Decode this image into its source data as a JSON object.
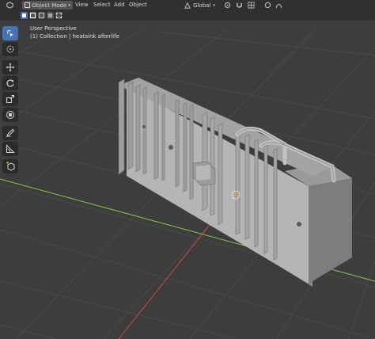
{
  "header": {
    "mode_label": "Object Mode",
    "menu": [
      "View",
      "Select",
      "Add",
      "Object"
    ],
    "transform_orientation": "Global"
  },
  "viewport": {
    "view_name": "User Perspective",
    "collection_info": "(1) Collection | heatsink afterlife"
  },
  "toolbar": {
    "tools": [
      "select-box",
      "cursor",
      "move",
      "rotate",
      "scale",
      "transform",
      "annotate",
      "measure",
      "add-cube"
    ],
    "active_tool": "select-box"
  },
  "colors": {
    "viewport_bg": "#3d3d3d",
    "grid_line": "#4a4a4a",
    "x_axis": "#8bc34a",
    "y_axis": "#c84a4a",
    "active_tool": "#4772b3",
    "model_light": "#b3b3b3",
    "model_dark": "#7a7a7a"
  }
}
